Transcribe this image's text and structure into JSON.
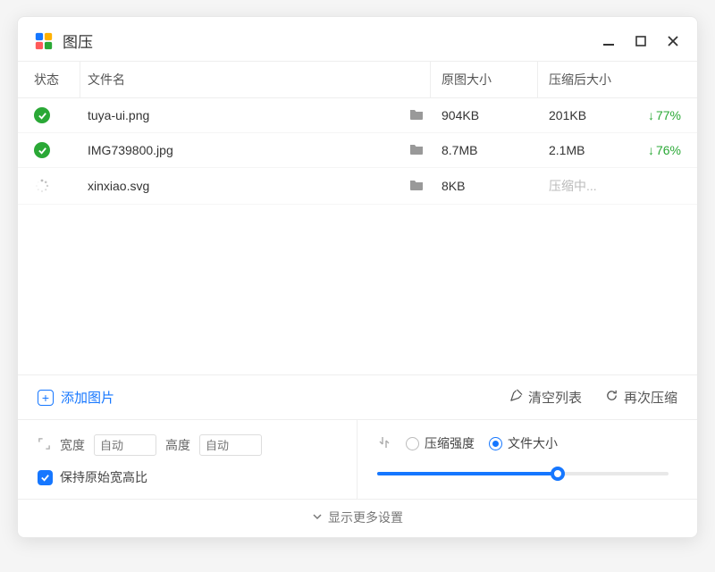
{
  "app": {
    "title": "图压",
    "icons": {
      "logo": "app-logo"
    }
  },
  "columns": {
    "status": "状态",
    "name": "文件名",
    "original": "原图大小",
    "compressed": "压缩后大小"
  },
  "files": [
    {
      "status": "done",
      "name": "tuya-ui.png",
      "original": "904KB",
      "compressed": "201KB",
      "reduction": "77%"
    },
    {
      "status": "done",
      "name": "IMG739800.jpg",
      "original": "8.7MB",
      "compressed": "2.1MB",
      "reduction": "76%"
    },
    {
      "status": "processing",
      "name": "xinxiao.svg",
      "original": "8KB",
      "compressed": "压缩中..."
    }
  ],
  "actions": {
    "add": "添加图片",
    "clear": "清空列表",
    "recompress": "再次压缩"
  },
  "settings": {
    "width_label": "宽度",
    "height_label": "高度",
    "auto_placeholder": "自动",
    "keep_aspect": "保持原始宽高比",
    "mode": {
      "strength": "压缩强度",
      "filesize": "文件大小",
      "selected": "filesize"
    },
    "slider_percent": 60,
    "show_more": "显示更多设置"
  }
}
